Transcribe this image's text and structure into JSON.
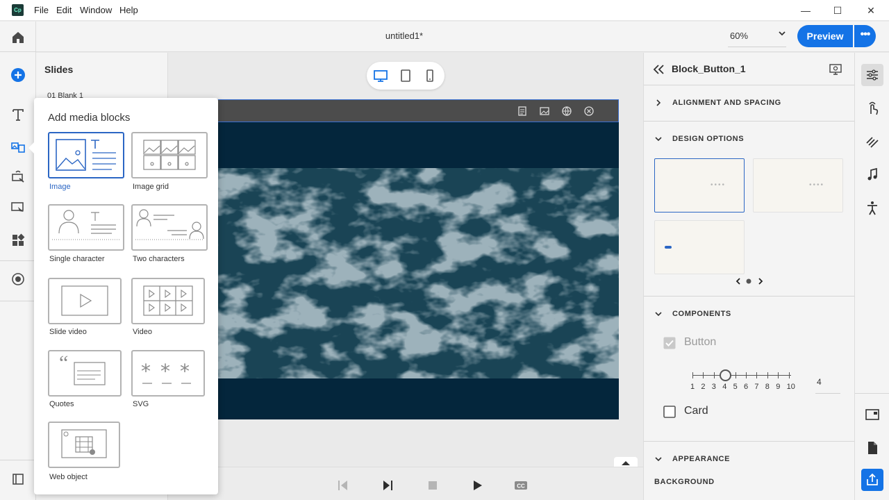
{
  "window": {
    "logo_text": "Cp",
    "menu": [
      "File",
      "Edit",
      "Window",
      "Help"
    ],
    "controls": {
      "minimize": "—",
      "maximize": "☐",
      "close": "✕"
    }
  },
  "header": {
    "doc_title": "untitled1*",
    "zoom": "60%",
    "preview_label": "Preview",
    "more_label": "•••"
  },
  "slides_panel": {
    "title": "Slides",
    "slides": [
      {
        "label": "01  Blank 1"
      }
    ]
  },
  "media_popover": {
    "title": "Add media blocks",
    "tiles": [
      {
        "label": "Image",
        "selected": true
      },
      {
        "label": "Image grid"
      },
      {
        "label": "Single character"
      },
      {
        "label": "Two characters"
      },
      {
        "label": "Slide video"
      },
      {
        "label": "Video"
      },
      {
        "label": "Quotes"
      },
      {
        "label": "SVG"
      },
      {
        "label": "Web object"
      }
    ]
  },
  "right_panel": {
    "title": "Block_Button_1",
    "sections": {
      "alignment": "ALIGNMENT AND SPACING",
      "design": "DESIGN OPTIONS",
      "components": "COMPONENTS",
      "appearance": "APPEARANCE"
    },
    "design_cards": [
      {
        "dots": "••••"
      },
      {
        "dots": "••••"
      },
      {
        "dots": ""
      }
    ],
    "design_pager": {
      "page": 1,
      "pages": 1
    },
    "components": {
      "button_label": "Button",
      "button_checked": true,
      "button_disabled": true,
      "slider_ticks": [
        "1",
        "2",
        "3",
        "4",
        "5",
        "6",
        "7",
        "8",
        "9",
        "10"
      ],
      "slider_value": "4",
      "card_label": "Card",
      "card_checked": false
    },
    "background_label": "BACKGROUND"
  },
  "colors": {
    "accent": "#1473e6",
    "selection": "#2b66c4",
    "slide_bg": "#04263c"
  }
}
